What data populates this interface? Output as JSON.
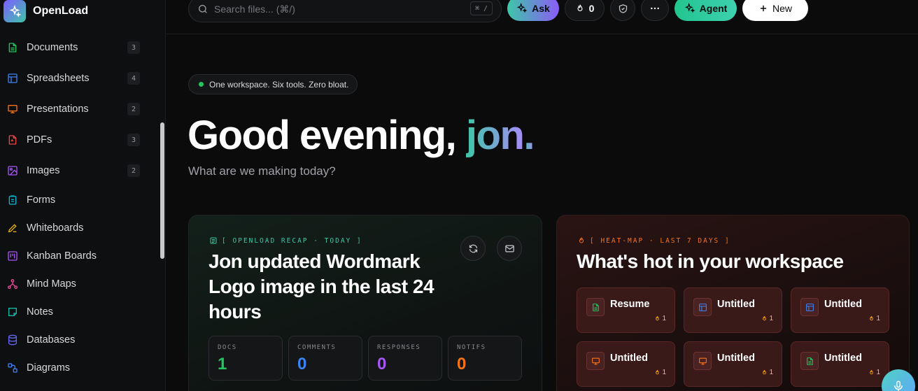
{
  "brand": {
    "name": "OpenLoad"
  },
  "sidebar": {
    "items": [
      {
        "label": "Documents",
        "count": "3",
        "icon": "document-icon",
        "color": "#22c55e"
      },
      {
        "label": "Spreadsheets",
        "count": "4",
        "icon": "table-icon",
        "color": "#3b82f6"
      },
      {
        "label": "Presentations",
        "count": "2",
        "icon": "presentation-icon",
        "color": "#f97316"
      },
      {
        "label": "PDFs",
        "count": "3",
        "icon": "pdf-icon",
        "color": "#ef4444"
      },
      {
        "label": "Images",
        "count": "2",
        "icon": "image-icon",
        "color": "#a855f7"
      },
      {
        "label": "Forms",
        "count": "",
        "icon": "clipboard-icon",
        "color": "#06b6d4"
      },
      {
        "label": "Whiteboards",
        "count": "",
        "icon": "pencil-icon",
        "color": "#eab308"
      },
      {
        "label": "Kanban Boards",
        "count": "",
        "icon": "kanban-icon",
        "color": "#a855f7"
      },
      {
        "label": "Mind Maps",
        "count": "",
        "icon": "mindmap-icon",
        "color": "#ec4899"
      },
      {
        "label": "Notes",
        "count": "",
        "icon": "note-icon",
        "color": "#14b8a6"
      },
      {
        "label": "Databases",
        "count": "",
        "icon": "database-icon",
        "color": "#6366f1"
      },
      {
        "label": "Diagrams",
        "count": "",
        "icon": "diagram-icon",
        "color": "#3b82f6"
      }
    ]
  },
  "topbar": {
    "search_placeholder": "Search files... (⌘/)",
    "shortcut": "⌘ /",
    "ask_label": "Ask",
    "streak_count": "0",
    "agent_label": "Agent",
    "new_label": "New"
  },
  "hero": {
    "tagline": "One workspace. Six tools. Zero bloat.",
    "greeting_prefix": "Good evening, ",
    "greeting_name": "jon",
    "greeting_suffix": ".",
    "subtitle": "What are we making today?"
  },
  "recap": {
    "eyebrow": "[ OPENLOAD RECAP · TODAY ]",
    "title": "Jon updated Wordmark Logo image in the last 24 hours",
    "stats": [
      {
        "label": "DOCS",
        "value": "1",
        "color": "#22c55e"
      },
      {
        "label": "COMMENTS",
        "value": "0",
        "color": "#3b82f6"
      },
      {
        "label": "RESPONSES",
        "value": "0",
        "color": "#a855f7"
      },
      {
        "label": "NOTIFS",
        "value": "0",
        "color": "#f97316"
      }
    ]
  },
  "heatmap": {
    "eyebrow": "[ HEAT-MAP · LAST 7 DAYS ]",
    "title": "What's hot in your workspace",
    "tiles": [
      {
        "name": "Resume",
        "count": "1",
        "icon": "document-icon",
        "color": "#22c55e"
      },
      {
        "name": "Untitled",
        "count": "1",
        "icon": "table-icon",
        "color": "#3b82f6"
      },
      {
        "name": "Untitled",
        "count": "1",
        "icon": "table-icon",
        "color": "#3b82f6"
      },
      {
        "name": "Untitled",
        "count": "1",
        "icon": "presentation-icon",
        "color": "#f97316"
      },
      {
        "name": "Untitled",
        "count": "1",
        "icon": "presentation-icon",
        "color": "#f97316"
      },
      {
        "name": "Untitled",
        "count": "1",
        "icon": "document-icon",
        "color": "#22c55e"
      }
    ]
  }
}
